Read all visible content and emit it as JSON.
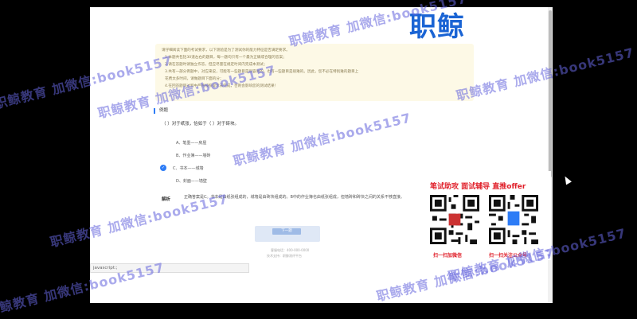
{
  "logo": {
    "text": "职鲸"
  },
  "notice": {
    "lines": [
      "请仔细阅读下面的考试要求，以下测验是为了测试你的能力特征是否满足要求。",
      "1.本题共包括30道左右的题目，每一题均只有一个最为正确或合理的答案；",
      "2.请在答题时请独立作答，但应尽量在规定时间内完成本测试；",
      "3.共有一部分例题中，对应来说，可能有一些题目是很容易的，也有一些题目是很难的。因此，您不必在特别难的题目上",
      "花费太多时间，请做题目下面的分；",
      "4.在回答题目过程中严格按照提示去完成，否则会影响您的测试结果！"
    ]
  },
  "question": {
    "section": "例题",
    "prompt": "（ ）对于纸张，恰如于（ ）对于砖块。",
    "options": [
      {
        "label": "A、笔墨——房屋",
        "selected": false
      },
      {
        "label": "B、作业簿——墙砖",
        "selected": false
      },
      {
        "label": "C、书本——城墙",
        "selected": true
      },
      {
        "label": "D、封面——墙壁",
        "selected": false
      }
    ],
    "analysis_label": "解析",
    "analysis": "正确答案是C。书本是由纸张组成的，城墙是由砖块组成的。B中的作业簿也由纸张组成，但墙砖和砖块之间的关系不够直接。"
  },
  "submit": {
    "label": "下一题"
  },
  "footer": {
    "line1": "客服电话：400-000-0000",
    "line2": "技术支持：职鲸测评平台"
  },
  "status_bar": {
    "text": "javascript:;"
  },
  "promo": {
    "title": "笔试助攻  面试辅导  直推offer",
    "caption_left": "扫一扫加微信",
    "caption_right": "扫一扫关注公众号"
  },
  "watermark": {
    "text": "职鲸教育 加微信:book5157"
  },
  "colors": {
    "accent": "#2d7cf6",
    "brand": "#1a64d4",
    "promo_red": "#e0202a",
    "watermark": "#6464dc"
  }
}
